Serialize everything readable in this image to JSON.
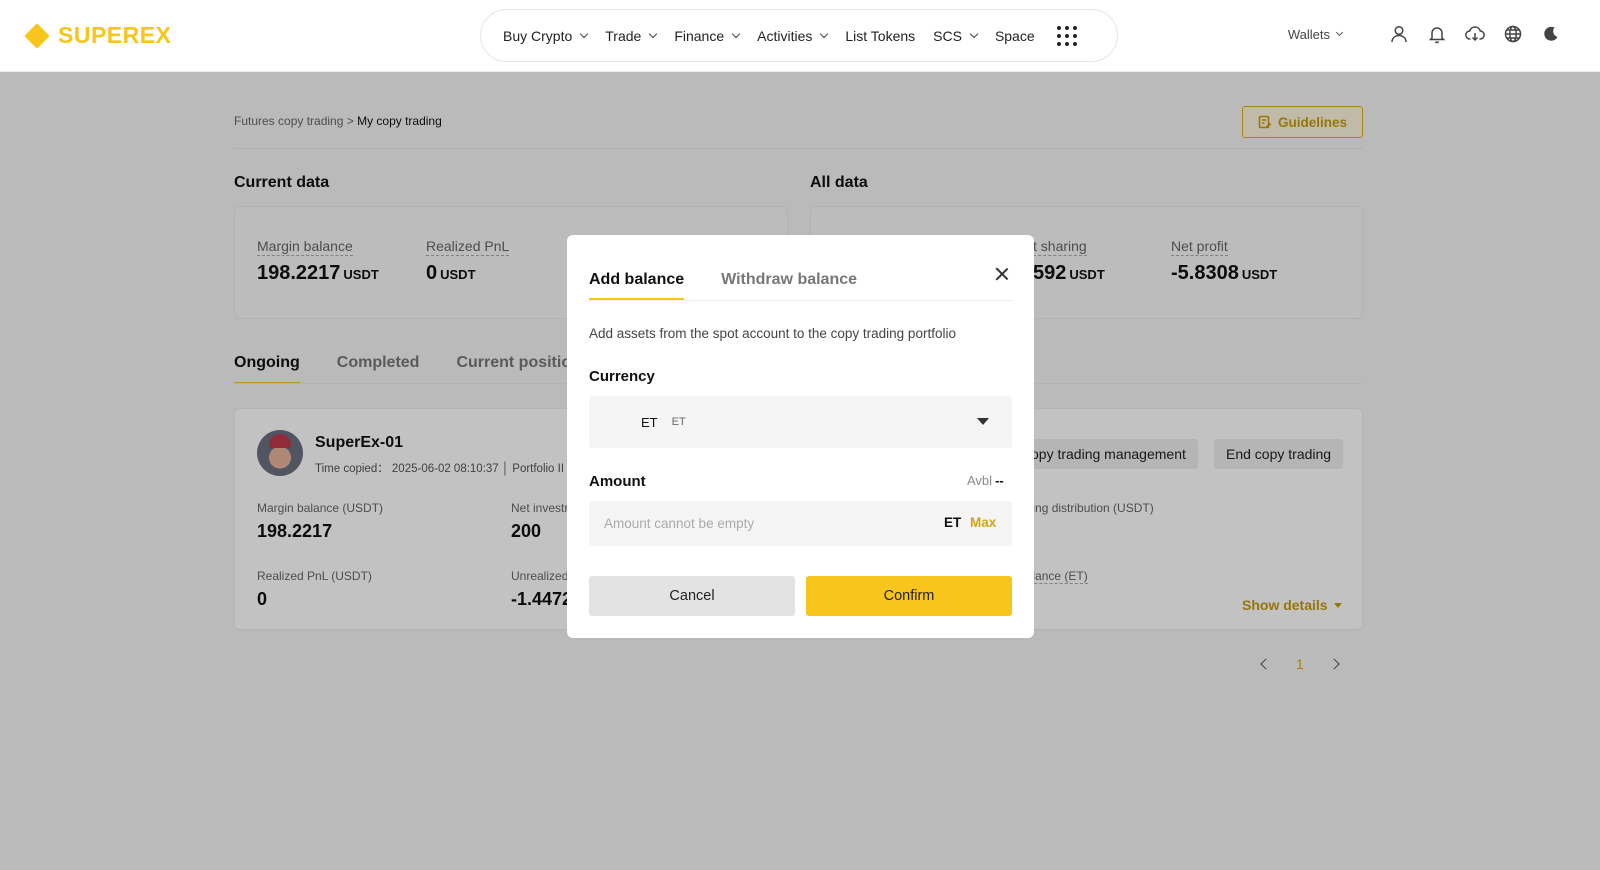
{
  "brand": {
    "name": "SUPEREX",
    "color": "#f8c51c"
  },
  "nav": {
    "items": [
      {
        "label": "Buy Crypto",
        "has_dropdown": true
      },
      {
        "label": "Trade",
        "has_dropdown": true
      },
      {
        "label": "Finance",
        "has_dropdown": true
      },
      {
        "label": "Activities",
        "has_dropdown": true
      },
      {
        "label": "List Tokens",
        "has_dropdown": false
      },
      {
        "label": "SCS",
        "has_dropdown": true
      },
      {
        "label": "Space",
        "has_dropdown": false
      }
    ],
    "wallets_label": "Wallets",
    "tools": [
      "user-icon",
      "bell-icon",
      "download-icon",
      "globe-icon",
      "moon-icon"
    ]
  },
  "page": {
    "breadcrumb_parent": "Futures copy trading >",
    "breadcrumb_current": "My copy trading",
    "guidelines_label": "Guidelines",
    "current_data": {
      "title": "Current data",
      "stats": [
        {
          "label": "Margin balance",
          "value": "198.2217",
          "unit": "USDT"
        },
        {
          "label": "Realized PnL",
          "value": "0",
          "unit": "USDT"
        }
      ]
    },
    "all_data": {
      "title": "All data",
      "stats": [
        {
          "label": "t sharing",
          "value": "592",
          "unit": "USDT"
        },
        {
          "label": "Net profit",
          "value": "-5.8308",
          "unit": "USDT"
        }
      ]
    },
    "tabs": [
      {
        "label": "Ongoing",
        "active": true
      },
      {
        "label": "Completed",
        "active": false
      },
      {
        "label": "Current position",
        "active": false
      }
    ],
    "copy_card": {
      "trader_name": "SuperEx-01",
      "time_copied": "Time copied： 2025-06-02 08:10:37 │ Portfolio II",
      "management_button": "opy trading management",
      "end_button": "End copy trading",
      "stats": [
        {
          "label": "Margin balance (USDT)",
          "value": "198.2217"
        },
        {
          "label": "Net investr",
          "value": "200"
        },
        {
          "label": "nding distribution (USDT)",
          "value": ""
        },
        {
          "label": "Realized PnL (USDT)",
          "value": "0"
        },
        {
          "label": "Unrealized",
          "value": "-1.4472"
        },
        {
          "label": "balance (ET)",
          "value": ""
        }
      ],
      "show_details": "Show details"
    },
    "pagination": {
      "current": "1"
    }
  },
  "modal": {
    "tabs": [
      {
        "label": "Add balance",
        "active": true
      },
      {
        "label": "Withdraw balance",
        "active": false
      }
    ],
    "description": "Add assets from the spot account to the copy trading portfolio",
    "currency_label": "Currency",
    "currency_code": "ET",
    "currency_sub": "ET",
    "amount_label": "Amount",
    "avbl_label": "Avbl",
    "avbl_value": "--",
    "amount_placeholder": "Amount cannot be empty",
    "amount_value": "",
    "amount_unit": "ET",
    "max_label": "Max",
    "cancel_label": "Cancel",
    "confirm_label": "Confirm"
  }
}
